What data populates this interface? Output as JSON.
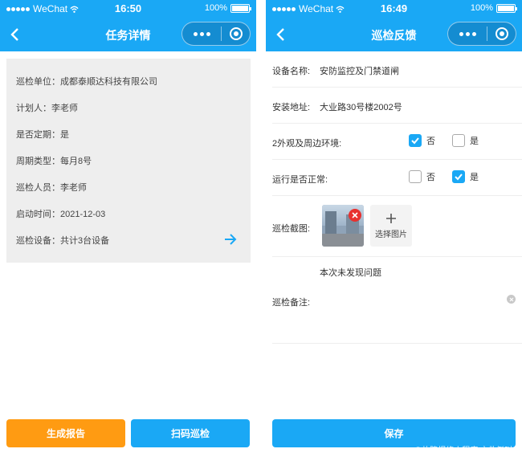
{
  "status": {
    "carrier": "WeChat",
    "left_time": "16:50",
    "right_time": "16:49",
    "battery": "100%"
  },
  "left": {
    "title": "任务详情",
    "rows": [
      "巡检单位：成都泰顺达科技有限公司",
      "计划人：李老师",
      "是否定期：是",
      "周期类型：每月8号",
      "巡检人员：李老师",
      "启动时间：2021-12-03",
      "巡检设备：共计3台设备"
    ],
    "report_button": "生成报告",
    "scan_button": "扫码巡检"
  },
  "right": {
    "title": "巡检反馈",
    "device_label": "设备名称:",
    "device_value": "安防监控及门禁道闸",
    "address_label": "安装地址:",
    "address_value": "大业路30号楼2002号",
    "appearance_label": "2外观及周边环境:",
    "appearance_options": {
      "no": "否",
      "yes": "是",
      "selected": "否"
    },
    "running_label": "运行是否正常:",
    "running_options": {
      "no": "否",
      "yes": "是",
      "selected": "是"
    },
    "screenshot_label": "巡检截图:",
    "choose_image": "选择图片",
    "remark_text": "本次未发现问题",
    "remark_label": "巡检备注:",
    "save_button": "保存",
    "watermark": "CSDN @故障报修小程序 文件倒叫"
  },
  "colors": {
    "primary": "#1aa8f5",
    "orange": "#ff9b12",
    "card": "#eeeeee",
    "danger": "#e8302e"
  }
}
